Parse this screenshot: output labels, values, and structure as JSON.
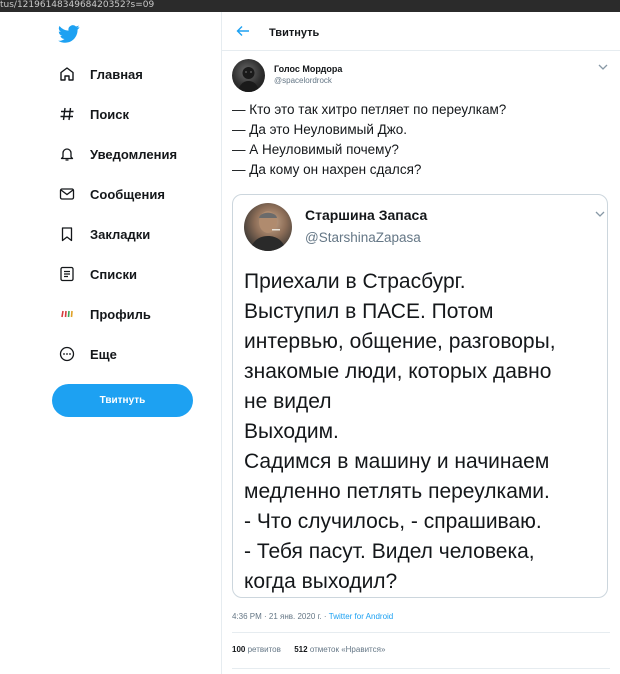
{
  "browser": {
    "url": "tus/1219614834968420352?s=09"
  },
  "sidebar": {
    "logo": "twitter-bird-icon",
    "items": [
      {
        "label": "Главная",
        "icon": "home-icon"
      },
      {
        "label": "Поиск",
        "icon": "hashtag-icon"
      },
      {
        "label": "Уведомления",
        "icon": "bell-icon"
      },
      {
        "label": "Сообщения",
        "icon": "envelope-icon"
      },
      {
        "label": "Закладки",
        "icon": "bookmark-icon"
      },
      {
        "label": "Списки",
        "icon": "list-icon"
      },
      {
        "label": "Профиль",
        "icon": "profile-avatar-icon"
      },
      {
        "label": "Еще",
        "icon": "more-icon"
      }
    ],
    "tweet_button": "Твитнуть"
  },
  "header": {
    "title": "Твитнуть"
  },
  "tweet": {
    "author_name": "Голос Мордора",
    "author_handle": "@spacelordrock",
    "lines": [
      "— Кто это так хитро петляет по переулкам?",
      "— Да это Неуловимый Джо.",
      "— А Неуловимый почему?",
      "— Да кому он нахрен сдался?"
    ],
    "quote": {
      "author_name": "Старшина Запаса",
      "author_handle": "@StarshinaZapasa",
      "lines": [
        "Приехали в Страсбург.",
        "Выступил в ПАСЕ. Потом",
        "интервью, общение, разговоры,",
        "знакомые люди, которых давно",
        "не видел",
        "Выходим.",
        "Садимся в машину и начинаем",
        "медленно петлять переулками.",
        "- Что случилось, - спрашиваю.",
        "- Тебя пасут. Видел человека,",
        "когда выходил?"
      ]
    },
    "timestamp": "4:36 PM · 21 янв. 2020 г. · ",
    "source": "Twitter for Android",
    "retweets_count": "100",
    "retweets_label": "ретвитов",
    "likes_count": "512",
    "likes_label": "отметок «Нравится»"
  },
  "colors": {
    "accent": "#1da1f2",
    "text": "#14171a",
    "secondary": "#657786",
    "border": "#e6ecf0"
  }
}
